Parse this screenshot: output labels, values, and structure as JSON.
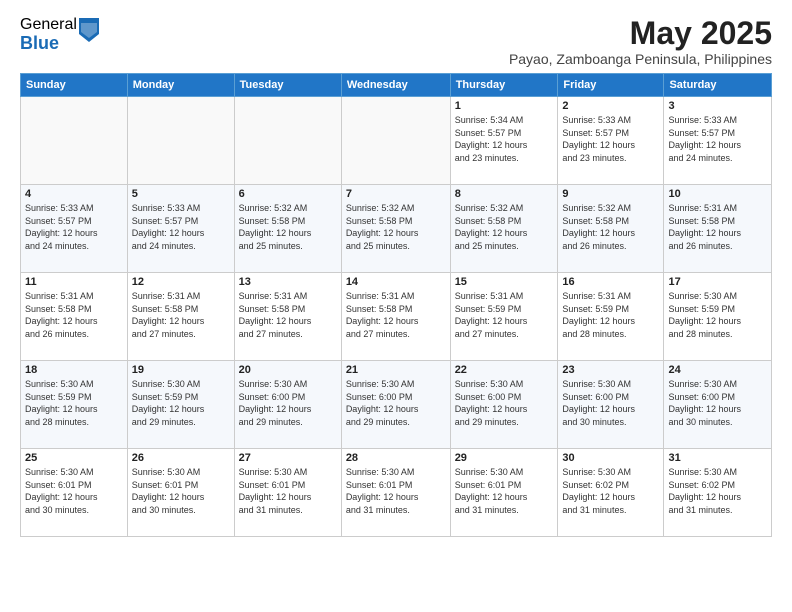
{
  "logo": {
    "general": "General",
    "blue": "Blue"
  },
  "title": "May 2025",
  "location": "Payao, Zamboanga Peninsula, Philippines",
  "days_of_week": [
    "Sunday",
    "Monday",
    "Tuesday",
    "Wednesday",
    "Thursday",
    "Friday",
    "Saturday"
  ],
  "weeks": [
    [
      {
        "day": "",
        "info": ""
      },
      {
        "day": "",
        "info": ""
      },
      {
        "day": "",
        "info": ""
      },
      {
        "day": "",
        "info": ""
      },
      {
        "day": "1",
        "info": "Sunrise: 5:34 AM\nSunset: 5:57 PM\nDaylight: 12 hours\nand 23 minutes."
      },
      {
        "day": "2",
        "info": "Sunrise: 5:33 AM\nSunset: 5:57 PM\nDaylight: 12 hours\nand 23 minutes."
      },
      {
        "day": "3",
        "info": "Sunrise: 5:33 AM\nSunset: 5:57 PM\nDaylight: 12 hours\nand 24 minutes."
      }
    ],
    [
      {
        "day": "4",
        "info": "Sunrise: 5:33 AM\nSunset: 5:57 PM\nDaylight: 12 hours\nand 24 minutes."
      },
      {
        "day": "5",
        "info": "Sunrise: 5:33 AM\nSunset: 5:57 PM\nDaylight: 12 hours\nand 24 minutes."
      },
      {
        "day": "6",
        "info": "Sunrise: 5:32 AM\nSunset: 5:58 PM\nDaylight: 12 hours\nand 25 minutes."
      },
      {
        "day": "7",
        "info": "Sunrise: 5:32 AM\nSunset: 5:58 PM\nDaylight: 12 hours\nand 25 minutes."
      },
      {
        "day": "8",
        "info": "Sunrise: 5:32 AM\nSunset: 5:58 PM\nDaylight: 12 hours\nand 25 minutes."
      },
      {
        "day": "9",
        "info": "Sunrise: 5:32 AM\nSunset: 5:58 PM\nDaylight: 12 hours\nand 26 minutes."
      },
      {
        "day": "10",
        "info": "Sunrise: 5:31 AM\nSunset: 5:58 PM\nDaylight: 12 hours\nand 26 minutes."
      }
    ],
    [
      {
        "day": "11",
        "info": "Sunrise: 5:31 AM\nSunset: 5:58 PM\nDaylight: 12 hours\nand 26 minutes."
      },
      {
        "day": "12",
        "info": "Sunrise: 5:31 AM\nSunset: 5:58 PM\nDaylight: 12 hours\nand 27 minutes."
      },
      {
        "day": "13",
        "info": "Sunrise: 5:31 AM\nSunset: 5:58 PM\nDaylight: 12 hours\nand 27 minutes."
      },
      {
        "day": "14",
        "info": "Sunrise: 5:31 AM\nSunset: 5:58 PM\nDaylight: 12 hours\nand 27 minutes."
      },
      {
        "day": "15",
        "info": "Sunrise: 5:31 AM\nSunset: 5:59 PM\nDaylight: 12 hours\nand 27 minutes."
      },
      {
        "day": "16",
        "info": "Sunrise: 5:31 AM\nSunset: 5:59 PM\nDaylight: 12 hours\nand 28 minutes."
      },
      {
        "day": "17",
        "info": "Sunrise: 5:30 AM\nSunset: 5:59 PM\nDaylight: 12 hours\nand 28 minutes."
      }
    ],
    [
      {
        "day": "18",
        "info": "Sunrise: 5:30 AM\nSunset: 5:59 PM\nDaylight: 12 hours\nand 28 minutes."
      },
      {
        "day": "19",
        "info": "Sunrise: 5:30 AM\nSunset: 5:59 PM\nDaylight: 12 hours\nand 29 minutes."
      },
      {
        "day": "20",
        "info": "Sunrise: 5:30 AM\nSunset: 6:00 PM\nDaylight: 12 hours\nand 29 minutes."
      },
      {
        "day": "21",
        "info": "Sunrise: 5:30 AM\nSunset: 6:00 PM\nDaylight: 12 hours\nand 29 minutes."
      },
      {
        "day": "22",
        "info": "Sunrise: 5:30 AM\nSunset: 6:00 PM\nDaylight: 12 hours\nand 29 minutes."
      },
      {
        "day": "23",
        "info": "Sunrise: 5:30 AM\nSunset: 6:00 PM\nDaylight: 12 hours\nand 30 minutes."
      },
      {
        "day": "24",
        "info": "Sunrise: 5:30 AM\nSunset: 6:00 PM\nDaylight: 12 hours\nand 30 minutes."
      }
    ],
    [
      {
        "day": "25",
        "info": "Sunrise: 5:30 AM\nSunset: 6:01 PM\nDaylight: 12 hours\nand 30 minutes."
      },
      {
        "day": "26",
        "info": "Sunrise: 5:30 AM\nSunset: 6:01 PM\nDaylight: 12 hours\nand 30 minutes."
      },
      {
        "day": "27",
        "info": "Sunrise: 5:30 AM\nSunset: 6:01 PM\nDaylight: 12 hours\nand 31 minutes."
      },
      {
        "day": "28",
        "info": "Sunrise: 5:30 AM\nSunset: 6:01 PM\nDaylight: 12 hours\nand 31 minutes."
      },
      {
        "day": "29",
        "info": "Sunrise: 5:30 AM\nSunset: 6:01 PM\nDaylight: 12 hours\nand 31 minutes."
      },
      {
        "day": "30",
        "info": "Sunrise: 5:30 AM\nSunset: 6:02 PM\nDaylight: 12 hours\nand 31 minutes."
      },
      {
        "day": "31",
        "info": "Sunrise: 5:30 AM\nSunset: 6:02 PM\nDaylight: 12 hours\nand 31 minutes."
      }
    ]
  ]
}
